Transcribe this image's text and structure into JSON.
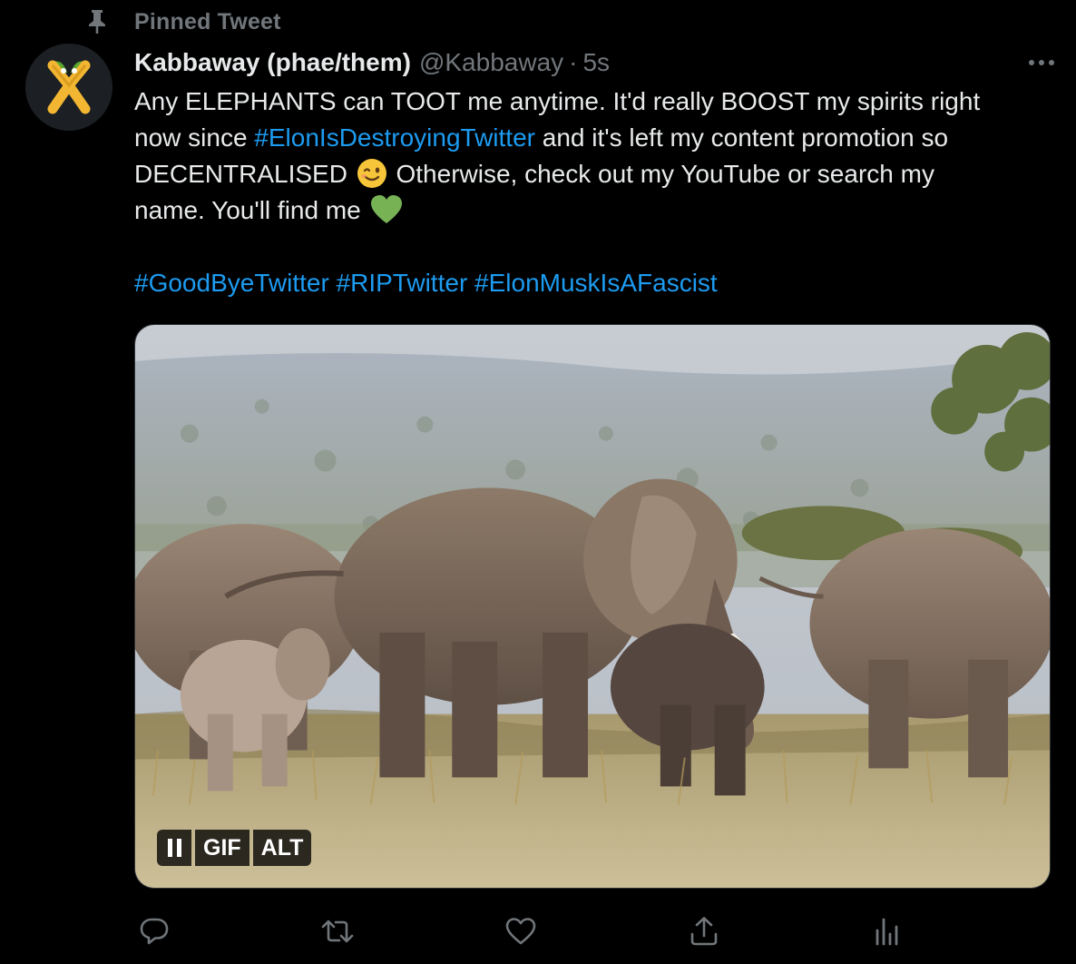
{
  "pinned": {
    "label": "Pinned Tweet",
    "icon": "pin-icon"
  },
  "author": {
    "name": "Kabbaway (phae/them)",
    "handle": "@Kabbaway",
    "separator": "·",
    "time": "5s",
    "avatar_colors": {
      "ring": "#1c1f23",
      "x": "#f2b632",
      "leaf": "#5aa832"
    }
  },
  "tweet": {
    "line1": "Any ELEPHANTS can TOOT me anytime. It'd really BOOST my spirits right",
    "line2_pre": "now since ",
    "line2_tag": "#ElonIsDestroyingTwitter",
    "line2_post": " and it's left my content promotion so",
    "line3_pre": "DECENTRALISED ",
    "line3_post": " Otherwise, check out my YouTube or search my",
    "line4": "name. You'll find me ",
    "emoji_wink": "winking-face-emoji",
    "emoji_heart": "green-heart-emoji",
    "hashtags": [
      "#GoodByeTwitter",
      "#RIPTwitter",
      "#ElonMuskIsAFascist"
    ]
  },
  "media": {
    "type": "gif",
    "subject": "elephants",
    "pause_icon": "pause-icon",
    "gif_label": "GIF",
    "alt_label": "ALT"
  },
  "actions": [
    {
      "name": "reply",
      "icon": "reply-icon"
    },
    {
      "name": "retweet",
      "icon": "retweet-icon"
    },
    {
      "name": "like",
      "icon": "heart-icon"
    },
    {
      "name": "share",
      "icon": "share-icon"
    },
    {
      "name": "analytics",
      "icon": "analytics-icon"
    }
  ],
  "colors": {
    "background": "#000000",
    "text": "#e7e9ea",
    "muted": "#71767b",
    "link": "#1d9bf0"
  }
}
